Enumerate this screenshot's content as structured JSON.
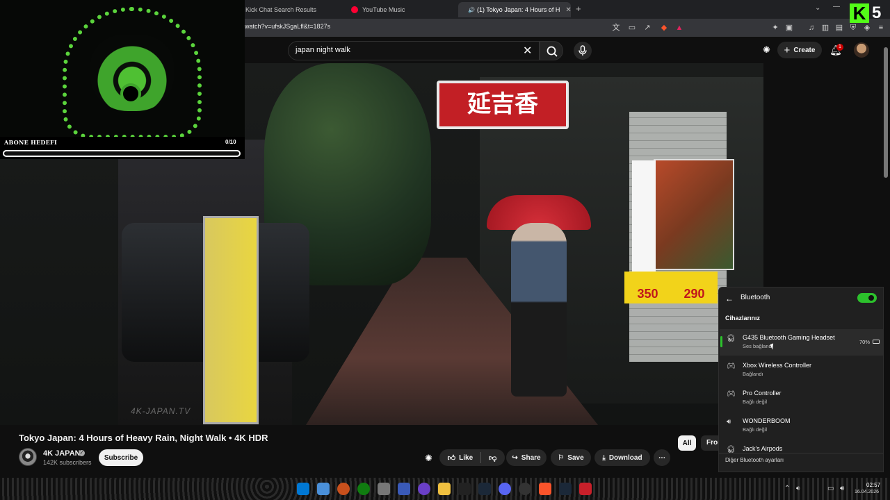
{
  "browser": {
    "tabs": [
      {
        "label": "Kick Chat Search Results",
        "active": false
      },
      {
        "label": "YouTube Music",
        "active": false
      },
      {
        "label": "(1) Tokyo Japan: 4 Hours of H",
        "active": true
      }
    ],
    "new_tab": "+",
    "url": "watch?v=ufskJSgaLfl&t=1827s"
  },
  "youtube": {
    "search_value": "japan night walk",
    "create_label": "Create",
    "notification_count": "1",
    "video_title": "Tokyo Japan: 4 Hours of Heavy Rain, Night Walk • 4K HDR",
    "channel_name": "4K JAPAN",
    "subscribers": "142K subscribers",
    "subscribe_label": "Subscribe",
    "actions": {
      "like": "Like",
      "share": "Share",
      "save": "Save",
      "download": "Download"
    },
    "chips": [
      "All",
      "From"
    ],
    "watermark": "4K-JAPAN.TV"
  },
  "video_scene": {
    "sign_red": "延吉香",
    "sign_yellow_left": "350",
    "sign_yellow_right": "290"
  },
  "overlay": {
    "goal_label": "ABONE HEDEFI",
    "goal_count": "0/10",
    "goal_progress": 0.0
  },
  "bluetooth": {
    "title": "Bluetooth",
    "enabled": true,
    "section": "Cihazlarınız",
    "devices": [
      {
        "name": "G435 Bluetooth Gaming Headset",
        "status": "Ses bağlandı",
        "battery": "70%",
        "icon": "headset-icon",
        "selected": true
      },
      {
        "name": "Xbox Wireless Controller",
        "status": "Bağlandı",
        "icon": "gamepad-icon"
      },
      {
        "name": "Pro Controller",
        "status": "Bağlı değil",
        "icon": "gamepad-icon"
      },
      {
        "name": "WONDERBOOM",
        "status": "Bağlı değil",
        "icon": "speaker-icon"
      },
      {
        "name": "Jack's Airpods",
        "status": "",
        "icon": "headphones-icon"
      }
    ],
    "more_settings": "Diğer Bluetooth ayarları",
    "accent": "#2cc12c"
  },
  "kick_logo": {
    "letter": "K",
    "number": "5",
    "color": "#53fc18"
  },
  "taskbar": {
    "time": "02:57",
    "date": "16.04.2026"
  }
}
